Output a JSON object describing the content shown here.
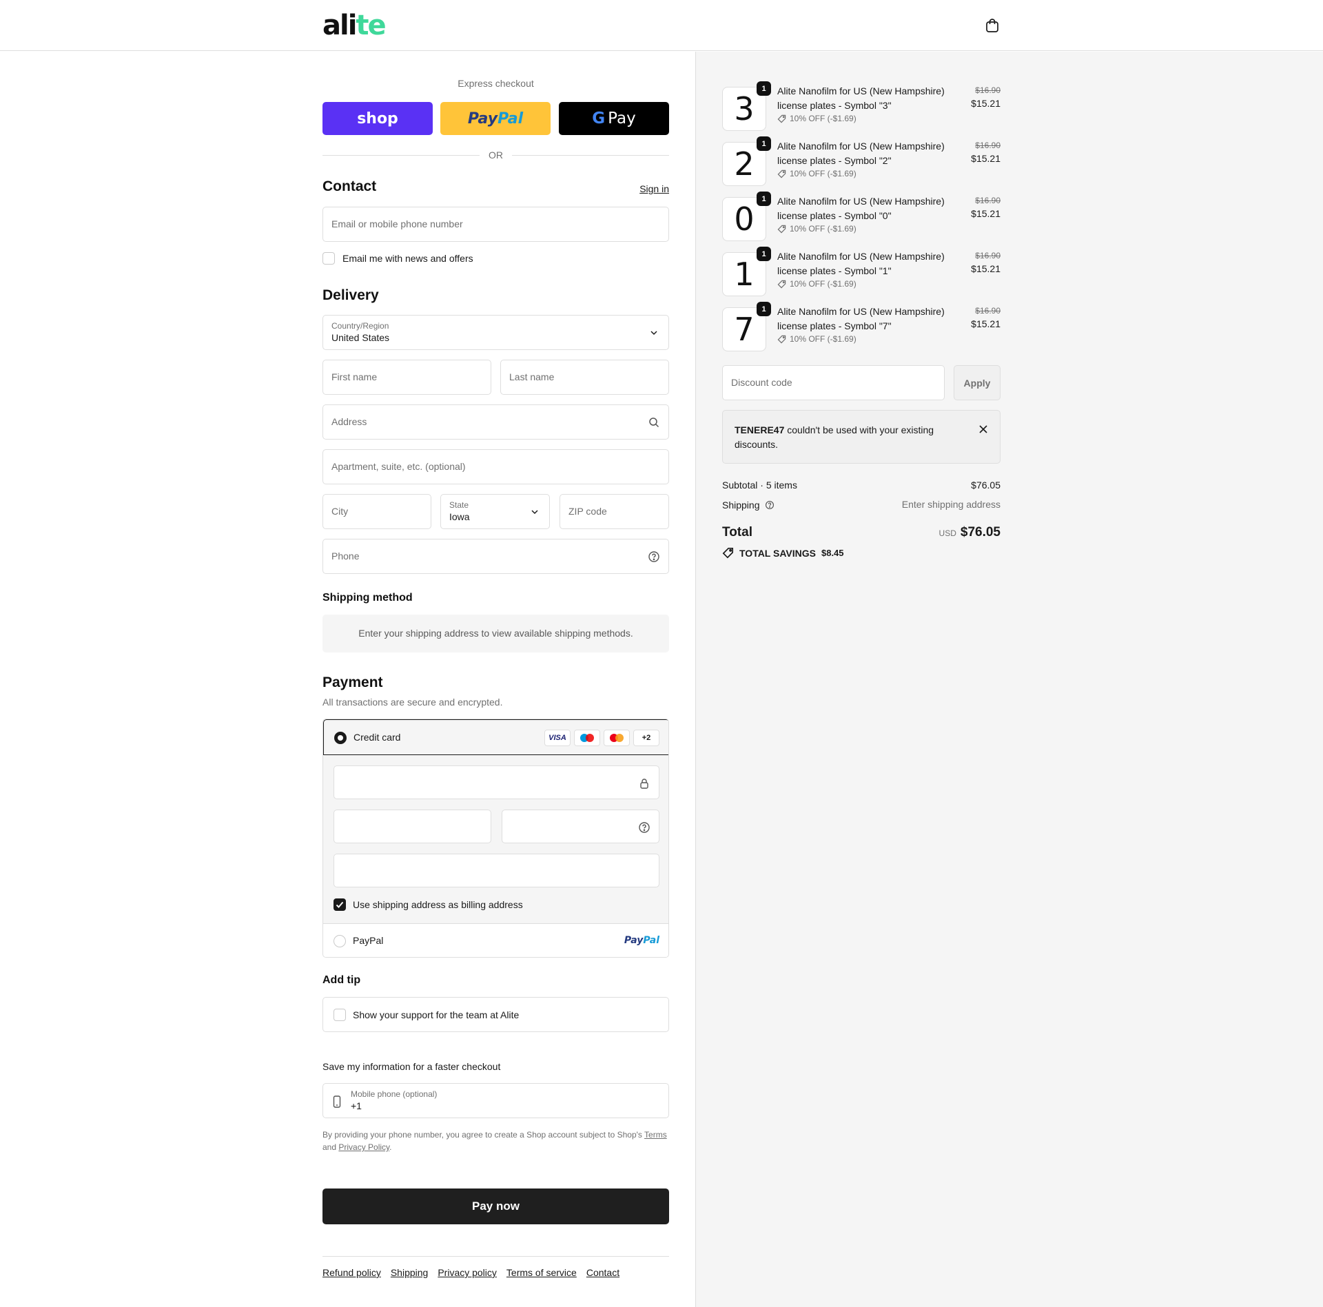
{
  "brand": {
    "logo_main": "ali",
    "logo_accent": "te"
  },
  "header": {
    "cart_icon": "shopping-bag-icon"
  },
  "express": {
    "label": "Express checkout",
    "shop_label": "shop",
    "paypal_pay": "Pay",
    "paypal_pal": "Pal",
    "gpay_g": "G",
    "gpay_label": "Pay",
    "or_label": "OR"
  },
  "contact": {
    "title": "Contact",
    "sign_in": "Sign in",
    "email_placeholder": "Email or mobile phone number",
    "news_label": "Email me with news and offers",
    "news_checked": false
  },
  "delivery": {
    "title": "Delivery",
    "country_label": "Country/Region",
    "country_value": "United States",
    "first_name_placeholder": "First name",
    "last_name_placeholder": "Last name",
    "address_placeholder": "Address",
    "apartment_placeholder": "Apartment, suite, etc. (optional)",
    "city_placeholder": "City",
    "state_label": "State",
    "state_value": "Iowa",
    "zip_placeholder": "ZIP code",
    "phone_placeholder": "Phone"
  },
  "shipping_method": {
    "title": "Shipping method",
    "message": "Enter your shipping address to view available shipping methods."
  },
  "payment": {
    "title": "Payment",
    "subtitle": "All transactions are secure and encrypted.",
    "credit_card_label": "Credit card",
    "card_badges": [
      "VISA",
      "maestro",
      "mastercard",
      "+2"
    ],
    "billing_label": "Use shipping address as billing address",
    "billing_checked": true,
    "paypal_label": "PayPal",
    "paypal_logo_pay": "Pay",
    "paypal_logo_pal": "Pal"
  },
  "tip": {
    "title": "Add tip",
    "label": "Show your support for the team at Alite"
  },
  "save_info": {
    "title": "Save my information for a faster checkout",
    "mobile_label": "Mobile phone (optional)",
    "mobile_value": "+1",
    "legal_prefix": "By providing your phone number, you agree to create a Shop account subject to Shop's ",
    "legal_terms": "Terms",
    "legal_and": "and ",
    "legal_privacy": "Privacy Policy",
    "legal_end": "."
  },
  "pay_now_label": "Pay now",
  "footer": {
    "links": [
      "Refund policy",
      "Shipping",
      "Privacy policy",
      "Terms of service",
      "Contact"
    ]
  },
  "order": {
    "items": [
      {
        "symbol": "3",
        "qty": "1",
        "title_line1": "Alite Nanofilm for US (New Hampshire)",
        "title_line2": "license plates - Symbol \"3\"",
        "discount": "10% OFF (-$1.69)",
        "old_price": "$16.90",
        "price": "$15.21"
      },
      {
        "symbol": "2",
        "qty": "1",
        "title_line1": "Alite Nanofilm for US (New Hampshire)",
        "title_line2": "license plates - Symbol \"2\"",
        "discount": "10% OFF (-$1.69)",
        "old_price": "$16.90",
        "price": "$15.21"
      },
      {
        "symbol": "0",
        "qty": "1",
        "title_line1": "Alite Nanofilm for US (New Hampshire)",
        "title_line2": "license plates - Symbol \"0\"",
        "discount": "10% OFF (-$1.69)",
        "old_price": "$16.90",
        "price": "$15.21"
      },
      {
        "symbol": "1",
        "qty": "1",
        "title_line1": "Alite Nanofilm for US (New Hampshire)",
        "title_line2": "license plates - Symbol \"1\"",
        "discount": "10% OFF (-$1.69)",
        "old_price": "$16.90",
        "price": "$15.21"
      },
      {
        "symbol": "7",
        "qty": "1",
        "title_line1": "Alite Nanofilm for US (New Hampshire)",
        "title_line2": "license plates - Symbol \"7\"",
        "discount": "10% OFF (-$1.69)",
        "old_price": "$16.90",
        "price": "$15.21"
      }
    ],
    "discount_placeholder": "Discount code",
    "apply_label": "Apply",
    "error_code": "TENERE47",
    "error_message": " couldn't be used with your existing discounts.",
    "subtotal_label": "Subtotal · 5 items",
    "subtotal_value": "$76.05",
    "shipping_label": "Shipping",
    "shipping_value": "Enter shipping address",
    "total_label": "Total",
    "total_currency": "USD",
    "total_value": "$76.05",
    "savings_label": "TOTAL SAVINGS",
    "savings_value": "$8.45"
  },
  "colors": {
    "shop_purple": "#5a31f4",
    "paypal_yellow": "#ffc439",
    "gpay_black": "#000000",
    "brand_green": "#3fd89a",
    "pay_now": "#1f1f1f"
  }
}
